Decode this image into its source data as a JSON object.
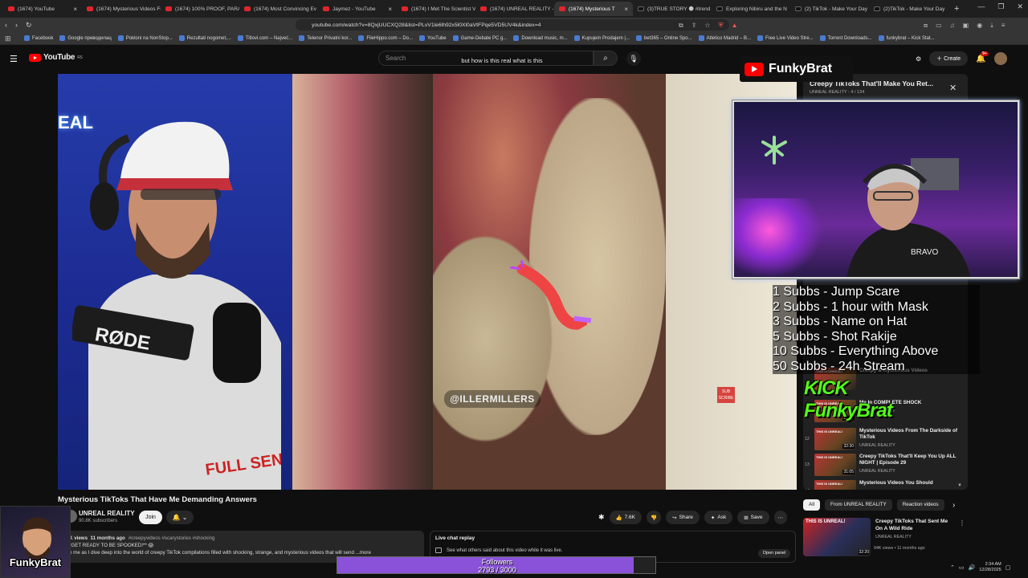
{
  "browser": {
    "tabs": [
      {
        "label": "(1674) YouTube",
        "icon": "yt"
      },
      {
        "label": "(1674) Mysterious Videos Fr",
        "icon": "yt"
      },
      {
        "label": "(1674) 100% PROOF, PARA",
        "icon": "yt"
      },
      {
        "label": "(1674) Most Convincing Ev",
        "icon": "yt"
      },
      {
        "label": "Jaymez - YouTube",
        "icon": "yt"
      },
      {
        "label": "(1674) I Met The Scientist V",
        "icon": "yt"
      },
      {
        "label": "(1674) UNREAL REALITY - Y",
        "icon": "yt"
      },
      {
        "label": "(1674) Mysterious T",
        "icon": "yt",
        "active": true
      },
      {
        "label": "(3)TRUE STORY 🌑 #trend",
        "icon": "tk"
      },
      {
        "label": "Exploring Nibiru and the N",
        "icon": "tk"
      },
      {
        "label": "(2) TikTok - Make Your Day",
        "icon": "tk"
      },
      {
        "label": "(2)TikTok - Make Your Day",
        "icon": "tk"
      }
    ],
    "url": "youtube.com/watch?v=8QxjUUCXQ28&list=PLvV1le6lh92x5l0Xl0aVtFPqe5VD5UV4k&index=4",
    "bookmarks": [
      "Facebook",
      "Google преводилац",
      "Pokloni na NonStop...",
      "Rezultati nogomet,...",
      "Titlovi.com – Najveć...",
      "Telenor Privatni kor...",
      "FileHippo.com – Do...",
      "YouTube",
      "Game-Debate PC g...",
      "Download music, m...",
      "Kupujem Prodajem |...",
      "bet365 – Online Spo...",
      "Atletico Madrid – B...",
      "Free Live Video Stre...",
      "Torrent Downloads...",
      "funkybrat – Kick Stat..."
    ]
  },
  "youtube": {
    "logo": "YouTube",
    "region": "RS",
    "search_placeholder": "Search",
    "create_label": "Create",
    "notif_count": "9+"
  },
  "video": {
    "caption": "but how is this real what is this",
    "watermark": "@ILLERMILLERS",
    "subscribe_badge": "SUB SCRIBE",
    "neon_text": "EAL",
    "title": "Mysterious TikToks That Have Me Demanding Answers"
  },
  "channel": {
    "name": "UNREAL REALITY",
    "subs": "90.8K subscribers",
    "join_label": "Join"
  },
  "actions": {
    "likes": "7.6K",
    "share": "Share",
    "ask": "Ask",
    "save": "Save"
  },
  "description": {
    "views": "K views",
    "age": "11 months ago",
    "tags": "#creepyvideos #scarystories #shocking",
    "line1": "*GET READY TO BE SPOOKED!** 😱",
    "line2": "n me as I dive deep into the world of creepy TikTok compilations filled with shocking, strange, and mysterious videos that will send ...more"
  },
  "live_chat": {
    "title": "Live chat replay",
    "text": "See what others said about this video while it was live.",
    "open_panel": "Open panel"
  },
  "playlist": {
    "title": "Creepy TikToks That'll Make You Ret...",
    "channel": "UNREAL REALITY",
    "position": "4 / 134",
    "items": [
      {
        "idx": "",
        "title": "Creepy & Mysterious Videos",
        "channel": "",
        "duration": ""
      },
      {
        "idx": "11",
        "title": "Me In COMPLETE SHOCK",
        "channel": "UNREAL REALITY",
        "duration": "31:26"
      },
      {
        "idx": "12",
        "title": "Mysterious Videos From The Darkside of TikTok",
        "channel": "UNREAL REALITY",
        "duration": "32:30"
      },
      {
        "idx": "13",
        "title": "Creepy TikToks That'll Keep You Up ALL NIGHT | Episode 29",
        "channel": "UNREAL REALITY",
        "duration": "31:05"
      },
      {
        "idx": "14",
        "title": "Mysterious Videos You Should",
        "channel": "",
        "duration": ""
      }
    ]
  },
  "chips": [
    "All",
    "From UNREAL REALITY",
    "Reaction videos"
  ],
  "recommended": {
    "title": "Creepy TikToks That Sent Me On A Wild Ride",
    "thumb_text": "THIS IS UNREAL!",
    "channel": "UNREAL REALITY",
    "meta": "94K views • 11 months ago",
    "duration": "32:20"
  },
  "overlay": {
    "brand": "FunkyBrat",
    "goals": [
      "1 Subbs - Jump Scare",
      "2 Subbs - 1 hour with Mask",
      "3 Subbs - Name on Hat",
      "5 Subbs - Shot Rakije",
      "10 Subbs - Everything Above",
      "50 Subbs - 24h Stream"
    ],
    "kick": "KICK FunkyBrat",
    "cam_label": "FunkyBrat",
    "followers_label": "Followers",
    "followers_count": "2793 / 3000",
    "followers_fraction": 0.931
  },
  "system": {
    "time": "2:34 AM",
    "date": "12/28/2025"
  }
}
